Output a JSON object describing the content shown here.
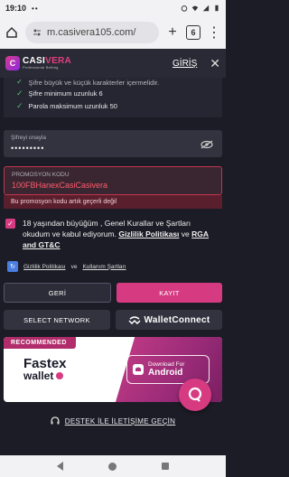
{
  "status": {
    "time": "19:10",
    "notif": "••"
  },
  "browser": {
    "url": "m.casivera105.com/",
    "tab_count": "6"
  },
  "header": {
    "brand_name_a": "CASI",
    "brand_name_b": "VERA",
    "brand_tag": "Professional Betting",
    "login": "GİRİŞ"
  },
  "rules": {
    "cut": "Şifre büyük ve küçük karakterler içermelidir.",
    "items": [
      "Şifre minimum uzunluk 6",
      "Parola maksimum uzunluk 50"
    ]
  },
  "confirm": {
    "label": "Şifreyi onayla",
    "value": "•••••••••"
  },
  "promo": {
    "label": "PROMOSYON KODU",
    "value": "100FBHanexCasiCasivera",
    "error": "Bu promosyon kodu artık geçerli değil"
  },
  "terms": {
    "text_a": "18 yaşından büyüğüm , Genel Kurallar ve Şartları okudum ve kabul ediyorum.",
    "link_privacy": "Gizlilik Politikası",
    "and": "ve",
    "link_rga": "RGA and GT&C"
  },
  "privacy": {
    "link_a": "Gizlilik Politikası",
    "and": "ve",
    "link_b": "Kullanım Şartları"
  },
  "buttons": {
    "back": "GERİ",
    "register": "KAYIT",
    "select_network": "SELECT NETWORK",
    "walletconnect": "WalletConnect"
  },
  "banner": {
    "badge": "RECOMMENDED",
    "brand_a": "Fastex",
    "brand_b": "wallet",
    "download_small": "Download For",
    "download_big": "Android"
  },
  "support": {
    "label": "DESTEK İLE İLETİŞİME GEÇİN"
  }
}
